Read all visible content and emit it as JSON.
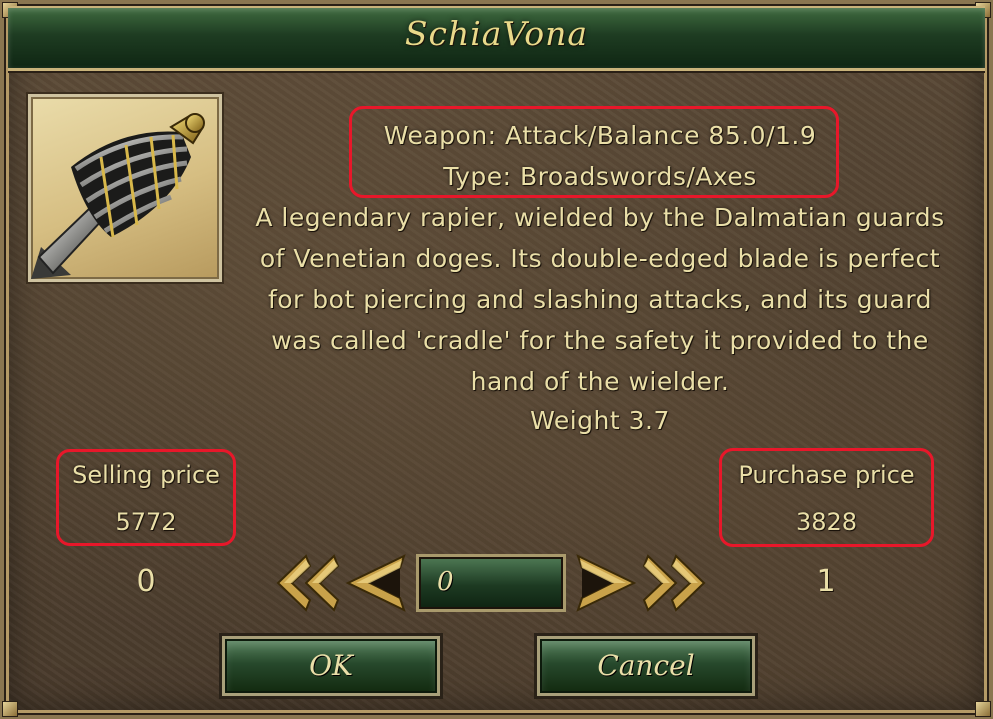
{
  "dialog": {
    "title": "SchiaVona"
  },
  "item": {
    "weapon_line": "Weapon: Attack/Balance 85.0/1.9",
    "type_line": "Type: Broadswords/Axes",
    "description": [
      "A legendary rapier, wielded by the Dalmatian guards",
      "of Venetian doges. Its double-edged blade is perfect",
      "for bot piercing and slashing attacks, and its guard",
      "was called 'cradle' for the safety it provided to the",
      "hand of the wielder."
    ],
    "weight_line": "Weight 3.7"
  },
  "selling": {
    "label": "Selling price",
    "value": "5772",
    "count": "0"
  },
  "purchase": {
    "label": "Purchase price",
    "value": "3828",
    "count": "1"
  },
  "quantity": {
    "value": "0"
  },
  "buttons": {
    "ok": "OK",
    "cancel": "Cancel"
  },
  "icons": {
    "first": "double-left-arrow-icon",
    "prev": "left-arrow-icon",
    "next": "right-arrow-icon",
    "last": "double-right-arrow-icon"
  },
  "colors": {
    "highlight": "#e8172a",
    "text": "#eadfa8",
    "title": "#e9d98a",
    "panel_green": "#1e3c22"
  }
}
